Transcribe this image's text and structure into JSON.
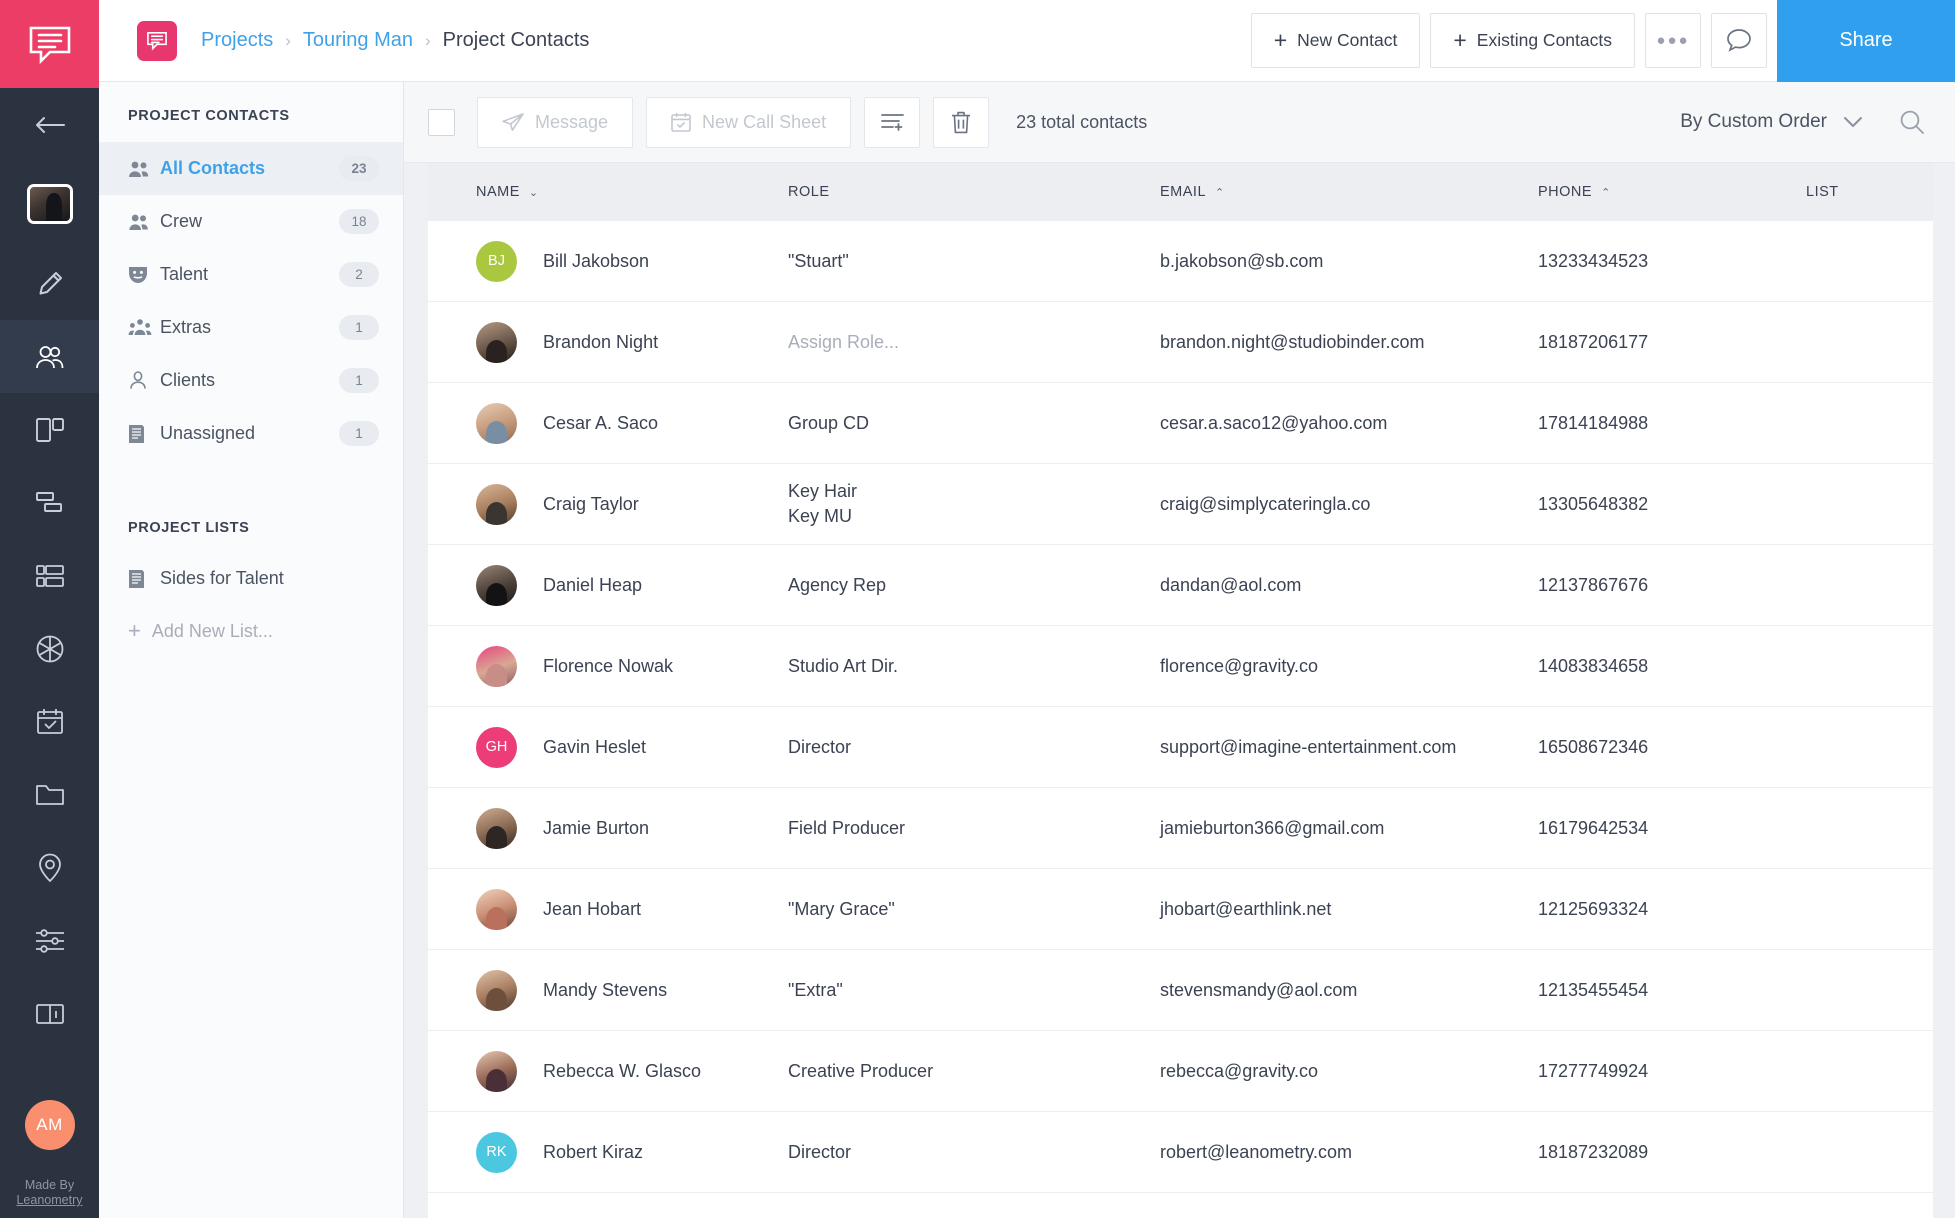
{
  "rail": {
    "items": [
      {
        "name": "back-arrow-icon",
        "label": "Back"
      },
      {
        "name": "project-thumbnail",
        "label": "Project Thumbnail"
      },
      {
        "name": "pencil-icon",
        "label": "Edit"
      },
      {
        "name": "contacts-icon",
        "label": "Contacts"
      },
      {
        "name": "storyboard-icon",
        "label": "Storyboards"
      },
      {
        "name": "shotlist-icon",
        "label": "Shot List"
      },
      {
        "name": "schedule-rows-icon",
        "label": "Schedule"
      },
      {
        "name": "aperture-icon",
        "label": "Shooting"
      },
      {
        "name": "calendar-check-icon",
        "label": "Calendar"
      },
      {
        "name": "folder-icon",
        "label": "Files"
      },
      {
        "name": "location-pin-icon",
        "label": "Locations"
      },
      {
        "name": "sliders-icon",
        "label": "Settings"
      },
      {
        "name": "book-info-icon",
        "label": "Guide"
      }
    ],
    "user_initials": "AM",
    "made_by_line1": "Made By",
    "made_by_line2": "Leanometry"
  },
  "header": {
    "logo_name": "studiobinder-logo",
    "breadcrumb": {
      "projects": "Projects",
      "project": "Touring Man",
      "current": "Project Contacts",
      "separator": "›"
    },
    "new_contact_label": "New Contact",
    "existing_contacts_label": "Existing Contacts",
    "plus": "+",
    "more_label": "●●●",
    "comment_icon": "comment-icon",
    "share_label": "Share"
  },
  "sidebar": {
    "section1_title": "PROJECT CONTACTS",
    "items": [
      {
        "label": "All Contacts",
        "count": "23",
        "icon": "group-contacts-icon",
        "active": true
      },
      {
        "label": "Crew",
        "count": "18",
        "icon": "crew-icon",
        "active": false
      },
      {
        "label": "Talent",
        "count": "2",
        "icon": "mask-icon",
        "active": false
      },
      {
        "label": "Extras",
        "count": "1",
        "icon": "extras-group-icon",
        "active": false
      },
      {
        "label": "Clients",
        "count": "1",
        "icon": "person-icon",
        "active": false
      },
      {
        "label": "Unassigned",
        "count": "1",
        "icon": "document-icon",
        "active": false
      }
    ],
    "section2_title": "PROJECT LISTS",
    "lists": [
      {
        "label": "Sides for Talent",
        "icon": "document-icon"
      }
    ],
    "add_new_list_label": "Add New List...",
    "add_plus": "+"
  },
  "toolbar": {
    "select_all_name": "select-all-checkbox",
    "message_label": "Message",
    "new_call_sheet_label": "New Call Sheet",
    "add_to_list_icon": "add-to-list-icon",
    "delete_icon": "trash-icon",
    "total_contacts": "23 total contacts",
    "sort_label": "By Custom Order",
    "sort_chevron": "chevron-down-icon",
    "search_icon": "search-icon"
  },
  "table": {
    "columns": [
      {
        "key": "name",
        "label": "NAME",
        "sort": "⌄"
      },
      {
        "key": "role",
        "label": "ROLE",
        "sort": ""
      },
      {
        "key": "email",
        "label": "EMAIL",
        "sort": "⌃"
      },
      {
        "key": "phone",
        "label": "PHONE",
        "sort": "⌃"
      },
      {
        "key": "list",
        "label": "LIST",
        "sort": ""
      }
    ],
    "rows": [
      {
        "name": "Bill Jakobson",
        "role": "\"Stuart\"",
        "role_muted": false,
        "email": "b.jakobson@sb.com",
        "phone": "13233434523",
        "list": "",
        "avatar": {
          "type": "initials",
          "text": "BJ",
          "color": "#aac83f"
        }
      },
      {
        "name": "Brandon Night",
        "role": "Assign Role...",
        "role_muted": true,
        "email": "brandon.night@studiobinder.com",
        "phone": "18187206177",
        "list": "",
        "avatar": {
          "type": "photo",
          "c1": "#b79a84",
          "c2": "#6d5a4c",
          "c3": "#211b17",
          "c4": "#2a2220"
        }
      },
      {
        "name": "Cesar A. Saco",
        "role": "Group CD",
        "role_muted": false,
        "email": "cesar.a.saco12@yahoo.com",
        "phone": "17814184988",
        "list": "",
        "avatar": {
          "type": "photo",
          "c1": "#e6cdb8",
          "c2": "#c69b7b",
          "c3": "#8d6a54",
          "c4": "#7a8ea3"
        }
      },
      {
        "name": "Craig Taylor",
        "role": "Key Hair\nKey MU",
        "role_muted": false,
        "email": "craig@simplycateringla.co",
        "phone": "13305648382",
        "list": "",
        "avatar": {
          "type": "photo",
          "c1": "#d8b79a",
          "c2": "#a97f5e",
          "c3": "#4c3a2c",
          "c4": "#3a3531"
        }
      },
      {
        "name": "Daniel Heap",
        "role": "Agency Rep",
        "role_muted": false,
        "email": "dandan@aol.com",
        "phone": "12137867676",
        "list": "",
        "avatar": {
          "type": "photo",
          "c1": "#9b8676",
          "c2": "#4f433c",
          "c3": "#191716",
          "c4": "#141313"
        }
      },
      {
        "name": "Florence Nowak",
        "role": "Studio Art Dir.",
        "role_muted": false,
        "email": "florence@gravity.co",
        "phone": "14083834658",
        "list": "",
        "avatar": {
          "type": "photo",
          "c1": "#e8457e",
          "c2": "#d8a894",
          "c3": "#8f5a63",
          "c4": "#c88d86"
        }
      },
      {
        "name": "Gavin Heslet",
        "role": "Director",
        "role_muted": false,
        "email": "support@imagine-entertainment.com",
        "phone": "16508672346",
        "list": "",
        "avatar": {
          "type": "initials",
          "text": "GH",
          "color": "#ec3d78"
        }
      },
      {
        "name": "Jamie Burton",
        "role": "Field Producer",
        "role_muted": false,
        "email": "jamieburton366@gmail.com",
        "phone": "16179642534",
        "list": "",
        "avatar": {
          "type": "photo",
          "c1": "#cfae93",
          "c2": "#8a6a52",
          "c3": "#332724",
          "c4": "#2d2623"
        }
      },
      {
        "name": "Jean Hobart",
        "role": "\"Mary Grace\"",
        "role_muted": false,
        "email": "jhobart@earthlink.net",
        "phone": "12125693324",
        "list": "",
        "avatar": {
          "type": "photo",
          "c1": "#f0d2bd",
          "c2": "#c98e73",
          "c3": "#6b4436",
          "c4": "#b9705c"
        }
      },
      {
        "name": "Mandy Stevens",
        "role": "\"Extra\"",
        "role_muted": false,
        "email": "stevensmandy@aol.com",
        "phone": "12135455454",
        "list": "",
        "avatar": {
          "type": "photo",
          "c1": "#e3c3a8",
          "c2": "#a87e62",
          "c3": "#4a3529",
          "c4": "#6d4f3c"
        }
      },
      {
        "name": "Rebecca W. Glasco",
        "role": "Creative Producer",
        "role_muted": false,
        "email": "rebecca@gravity.co",
        "phone": "17277749924",
        "list": "",
        "avatar": {
          "type": "photo",
          "c1": "#e7c9b3",
          "c2": "#9a6c58",
          "c3": "#3f2a30",
          "c4": "#4b2f38"
        }
      },
      {
        "name": "Robert Kiraz",
        "role": "Director",
        "role_muted": false,
        "email": "robert@leanometry.com",
        "phone": "18187232089",
        "list": "",
        "avatar": {
          "type": "initials",
          "text": "RK",
          "color": "#4bc8e0"
        }
      }
    ]
  },
  "colors": {
    "brand_pink": "#ec3d66",
    "accent_blue": "#3fa2e8",
    "share_blue": "#2f9fee",
    "rail_bg": "#2b3240"
  }
}
